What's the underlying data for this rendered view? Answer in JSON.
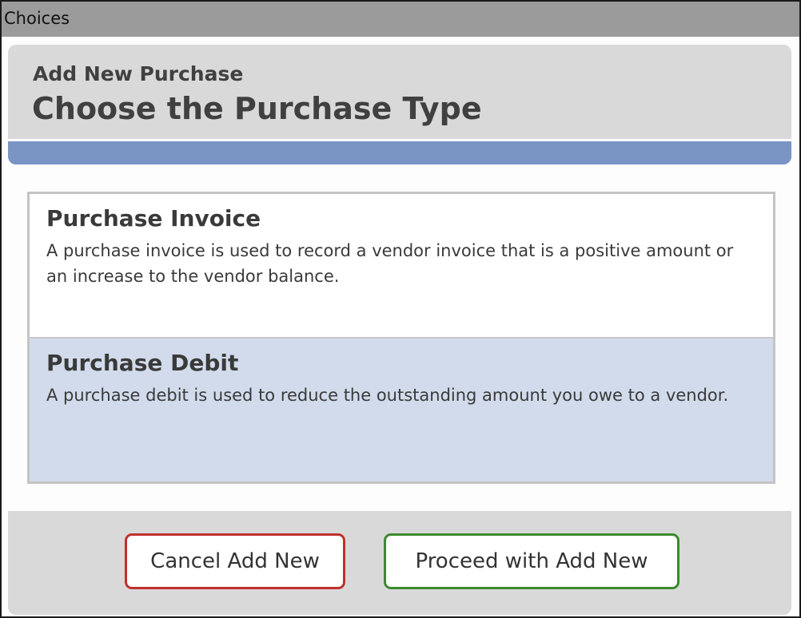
{
  "window": {
    "title": "Choices"
  },
  "header": {
    "subtitle": "Add New Purchase",
    "title": "Choose the Purchase Type"
  },
  "choices": [
    {
      "title": "Purchase Invoice",
      "description": "A purchase invoice is used to record a vendor invoice that is a positive amount or an increase to the vendor balance.",
      "selected": false
    },
    {
      "title": "Purchase Debit",
      "description": "A purchase debit is used to reduce the outstanding amount you owe to a vendor.",
      "selected": true
    }
  ],
  "footer": {
    "cancel_label": "Cancel Add New",
    "proceed_label": "Proceed with Add New"
  },
  "colors": {
    "titlebar": "#9b9b9b",
    "header_band": "#7a94c4",
    "selected_row": "#d1dbeb",
    "cancel_border": "#c0302b",
    "proceed_border": "#3b8a2e"
  }
}
